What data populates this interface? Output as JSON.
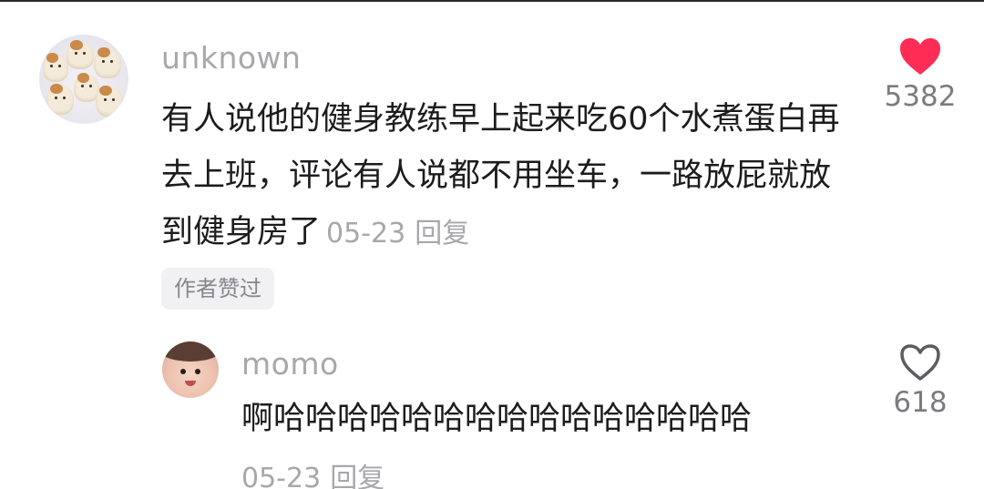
{
  "comment": {
    "username": "unknown",
    "text": "有人说他的健身教练早上起来吃60个水煮蛋白再去上班，评论有人说都不用坐车，一路放屁就放到健身房了",
    "date": "05-23",
    "reply_label": "回复",
    "author_liked_label": "作者赞过",
    "like_count": "5382",
    "liked": true,
    "avatar_icon": "hamster-avatar-icon",
    "like_icon": "heart-filled-icon"
  },
  "reply": {
    "username": "momo",
    "text": "啊哈哈哈哈哈哈哈哈哈哈哈哈哈哈哈",
    "date": "05-23",
    "reply_label": "回复",
    "like_count": "618",
    "liked": false,
    "avatar_icon": "girl-avatar-icon",
    "like_icon": "heart-outline-icon"
  },
  "colors": {
    "heart_liked": "#ff2c55",
    "heart_outline": "#5c5c61",
    "text_primary": "#1c1c1e",
    "text_secondary": "#a7a7ac"
  }
}
